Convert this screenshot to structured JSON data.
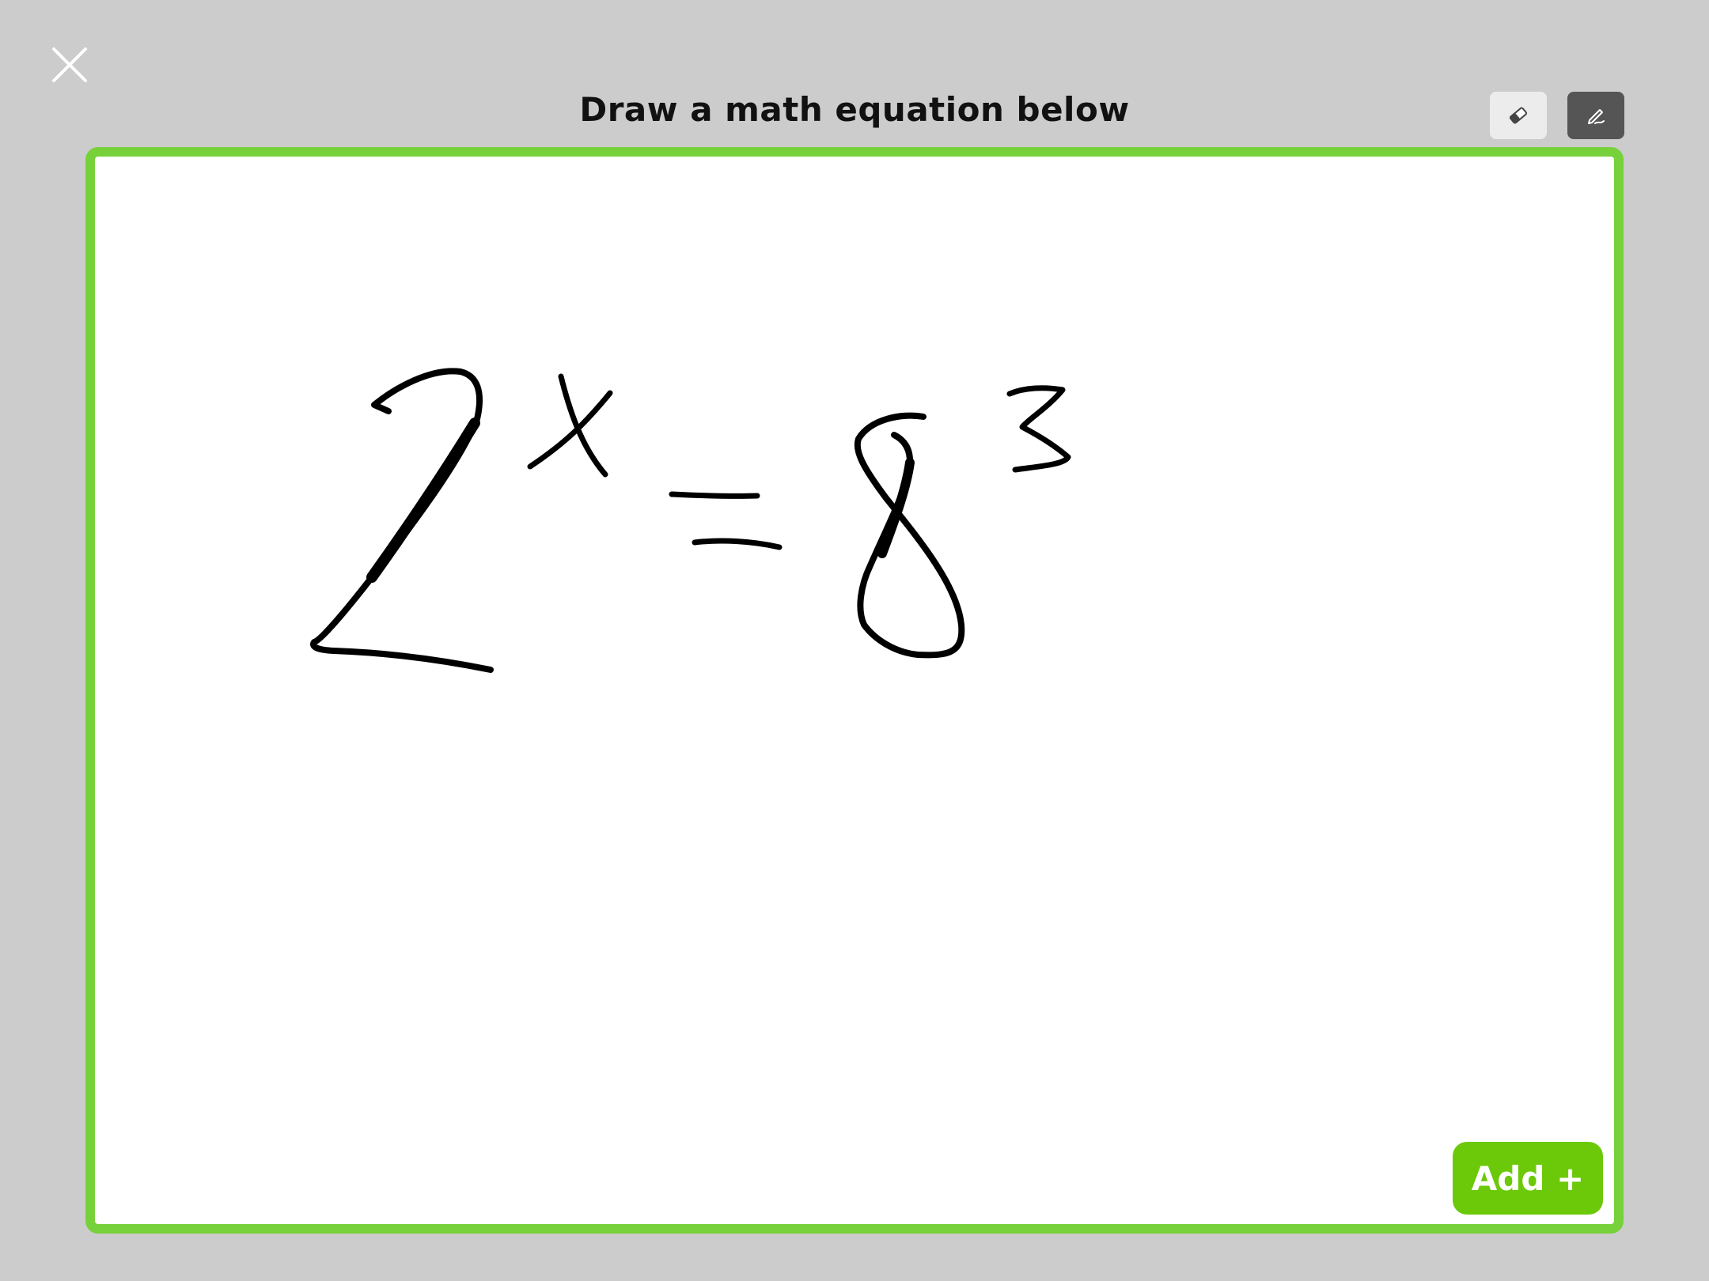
{
  "header": {
    "title": "Draw a math equation below",
    "close_icon": "close-icon"
  },
  "toolbar": {
    "eraser_icon": "eraser-icon",
    "pen_icon": "pen-icon",
    "active_tool": "pen"
  },
  "canvas": {
    "border_color": "#77d13a",
    "ink_color": "#000000"
  },
  "actions": {
    "add_label": "Add +",
    "add_color": "#6cc90a"
  }
}
